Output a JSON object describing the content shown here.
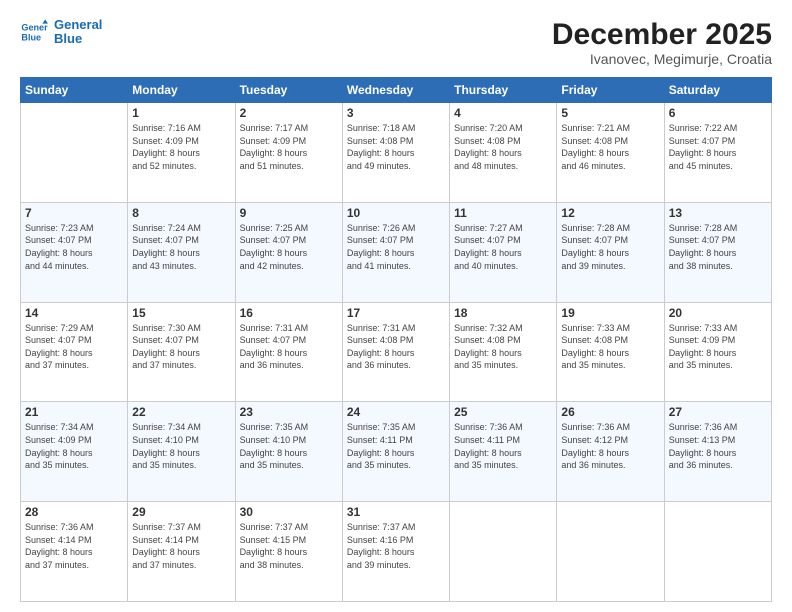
{
  "header": {
    "logo_line1": "General",
    "logo_line2": "Blue",
    "main_title": "December 2025",
    "subtitle": "Ivanovec, Megimurje, Croatia"
  },
  "days_of_week": [
    "Sunday",
    "Monday",
    "Tuesday",
    "Wednesday",
    "Thursday",
    "Friday",
    "Saturday"
  ],
  "weeks": [
    [
      {
        "day": "",
        "info": ""
      },
      {
        "day": "1",
        "info": "Sunrise: 7:16 AM\nSunset: 4:09 PM\nDaylight: 8 hours\nand 52 minutes."
      },
      {
        "day": "2",
        "info": "Sunrise: 7:17 AM\nSunset: 4:09 PM\nDaylight: 8 hours\nand 51 minutes."
      },
      {
        "day": "3",
        "info": "Sunrise: 7:18 AM\nSunset: 4:08 PM\nDaylight: 8 hours\nand 49 minutes."
      },
      {
        "day": "4",
        "info": "Sunrise: 7:20 AM\nSunset: 4:08 PM\nDaylight: 8 hours\nand 48 minutes."
      },
      {
        "day": "5",
        "info": "Sunrise: 7:21 AM\nSunset: 4:08 PM\nDaylight: 8 hours\nand 46 minutes."
      },
      {
        "day": "6",
        "info": "Sunrise: 7:22 AM\nSunset: 4:07 PM\nDaylight: 8 hours\nand 45 minutes."
      }
    ],
    [
      {
        "day": "7",
        "info": "Sunrise: 7:23 AM\nSunset: 4:07 PM\nDaylight: 8 hours\nand 44 minutes."
      },
      {
        "day": "8",
        "info": "Sunrise: 7:24 AM\nSunset: 4:07 PM\nDaylight: 8 hours\nand 43 minutes."
      },
      {
        "day": "9",
        "info": "Sunrise: 7:25 AM\nSunset: 4:07 PM\nDaylight: 8 hours\nand 42 minutes."
      },
      {
        "day": "10",
        "info": "Sunrise: 7:26 AM\nSunset: 4:07 PM\nDaylight: 8 hours\nand 41 minutes."
      },
      {
        "day": "11",
        "info": "Sunrise: 7:27 AM\nSunset: 4:07 PM\nDaylight: 8 hours\nand 40 minutes."
      },
      {
        "day": "12",
        "info": "Sunrise: 7:28 AM\nSunset: 4:07 PM\nDaylight: 8 hours\nand 39 minutes."
      },
      {
        "day": "13",
        "info": "Sunrise: 7:28 AM\nSunset: 4:07 PM\nDaylight: 8 hours\nand 38 minutes."
      }
    ],
    [
      {
        "day": "14",
        "info": "Sunrise: 7:29 AM\nSunset: 4:07 PM\nDaylight: 8 hours\nand 37 minutes."
      },
      {
        "day": "15",
        "info": "Sunrise: 7:30 AM\nSunset: 4:07 PM\nDaylight: 8 hours\nand 37 minutes."
      },
      {
        "day": "16",
        "info": "Sunrise: 7:31 AM\nSunset: 4:07 PM\nDaylight: 8 hours\nand 36 minutes."
      },
      {
        "day": "17",
        "info": "Sunrise: 7:31 AM\nSunset: 4:08 PM\nDaylight: 8 hours\nand 36 minutes."
      },
      {
        "day": "18",
        "info": "Sunrise: 7:32 AM\nSunset: 4:08 PM\nDaylight: 8 hours\nand 35 minutes."
      },
      {
        "day": "19",
        "info": "Sunrise: 7:33 AM\nSunset: 4:08 PM\nDaylight: 8 hours\nand 35 minutes."
      },
      {
        "day": "20",
        "info": "Sunrise: 7:33 AM\nSunset: 4:09 PM\nDaylight: 8 hours\nand 35 minutes."
      }
    ],
    [
      {
        "day": "21",
        "info": "Sunrise: 7:34 AM\nSunset: 4:09 PM\nDaylight: 8 hours\nand 35 minutes."
      },
      {
        "day": "22",
        "info": "Sunrise: 7:34 AM\nSunset: 4:10 PM\nDaylight: 8 hours\nand 35 minutes."
      },
      {
        "day": "23",
        "info": "Sunrise: 7:35 AM\nSunset: 4:10 PM\nDaylight: 8 hours\nand 35 minutes."
      },
      {
        "day": "24",
        "info": "Sunrise: 7:35 AM\nSunset: 4:11 PM\nDaylight: 8 hours\nand 35 minutes."
      },
      {
        "day": "25",
        "info": "Sunrise: 7:36 AM\nSunset: 4:11 PM\nDaylight: 8 hours\nand 35 minutes."
      },
      {
        "day": "26",
        "info": "Sunrise: 7:36 AM\nSunset: 4:12 PM\nDaylight: 8 hours\nand 36 minutes."
      },
      {
        "day": "27",
        "info": "Sunrise: 7:36 AM\nSunset: 4:13 PM\nDaylight: 8 hours\nand 36 minutes."
      }
    ],
    [
      {
        "day": "28",
        "info": "Sunrise: 7:36 AM\nSunset: 4:14 PM\nDaylight: 8 hours\nand 37 minutes."
      },
      {
        "day": "29",
        "info": "Sunrise: 7:37 AM\nSunset: 4:14 PM\nDaylight: 8 hours\nand 37 minutes."
      },
      {
        "day": "30",
        "info": "Sunrise: 7:37 AM\nSunset: 4:15 PM\nDaylight: 8 hours\nand 38 minutes."
      },
      {
        "day": "31",
        "info": "Sunrise: 7:37 AM\nSunset: 4:16 PM\nDaylight: 8 hours\nand 39 minutes."
      },
      {
        "day": "",
        "info": ""
      },
      {
        "day": "",
        "info": ""
      },
      {
        "day": "",
        "info": ""
      }
    ]
  ]
}
